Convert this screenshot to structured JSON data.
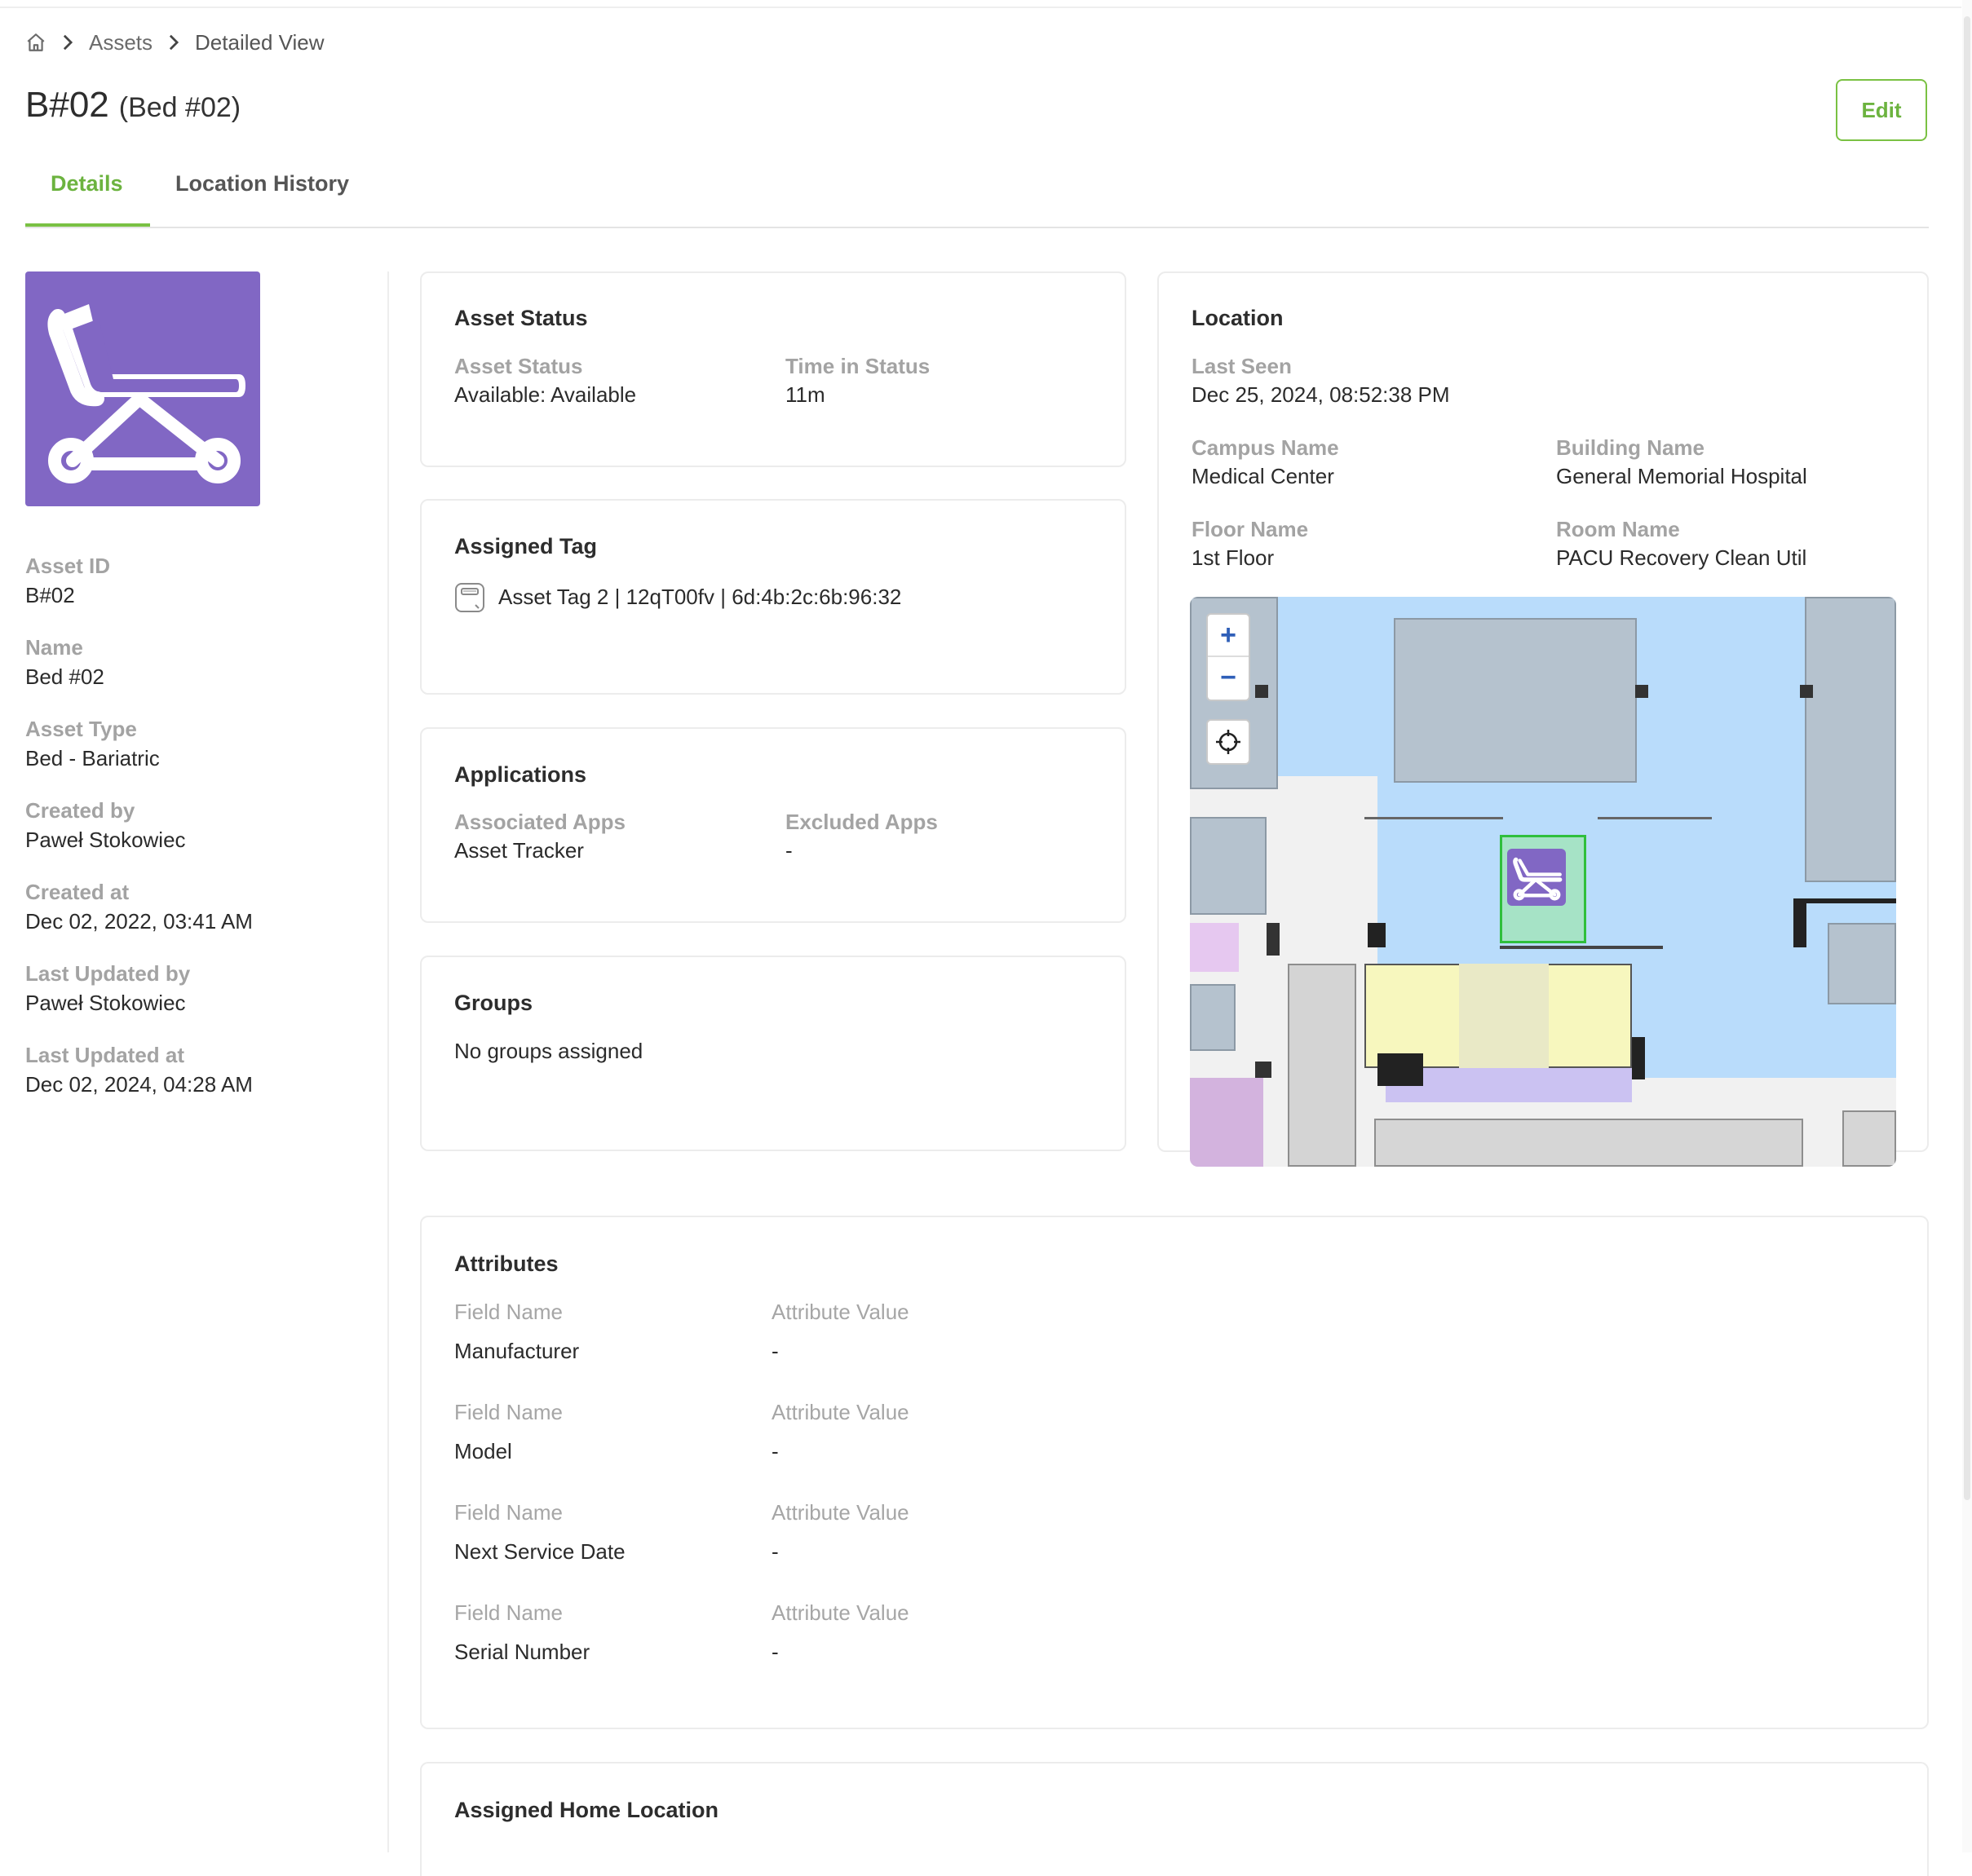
{
  "breadcrumb": {
    "home_icon": "home-icon",
    "items": [
      "Assets",
      "Detailed View"
    ]
  },
  "header": {
    "title": "B#02",
    "subtitle": "(Bed #02)",
    "edit_label": "Edit"
  },
  "tabs": [
    {
      "label": "Details",
      "active": true
    },
    {
      "label": "Location History",
      "active": false
    }
  ],
  "asset_icon": "bed-icon",
  "colors": {
    "accent": "#7ac143",
    "asset_purple": "#8167c4",
    "map_water": "#b9dcfb",
    "marker_border": "#2fbf3c"
  },
  "left_meta": [
    {
      "label": "Asset ID",
      "value": "B#02"
    },
    {
      "label": "Name",
      "value": "Bed #02"
    },
    {
      "label": "Asset Type",
      "value": "Bed - Bariatric"
    },
    {
      "label": "Created by",
      "value": "Paweł Stokowiec"
    },
    {
      "label": "Created at",
      "value": "Dec 02, 2022, 03:41 AM"
    },
    {
      "label": "Last Updated by",
      "value": "Paweł Stokowiec"
    },
    {
      "label": "Last Updated at",
      "value": "Dec 02, 2024, 04:28 AM"
    }
  ],
  "asset_status": {
    "title": "Asset Status",
    "status_label": "Asset Status",
    "status_value": "Available: Available",
    "time_label": "Time in Status",
    "time_value": "11m"
  },
  "assigned_tag": {
    "title": "Assigned Tag",
    "tag_icon": "tag-icon",
    "value": "Asset Tag 2 | 12qT00fv | 6d:4b:2c:6b:96:32"
  },
  "applications": {
    "title": "Applications",
    "associated_label": "Associated Apps",
    "associated_value": "Asset Tracker",
    "excluded_label": "Excluded Apps",
    "excluded_value": "-"
  },
  "groups": {
    "title": "Groups",
    "empty_text": "No groups assigned"
  },
  "location": {
    "title": "Location",
    "last_seen_label": "Last Seen",
    "last_seen_value": "Dec 25, 2024, 08:52:38 PM",
    "campus_label": "Campus Name",
    "campus_value": "Medical Center",
    "building_label": "Building Name",
    "building_value": "General Memorial Hospital",
    "floor_label": "Floor Name",
    "floor_value": "1st Floor",
    "room_label": "Room Name",
    "room_value": "PACU Recovery Clean Util",
    "zoom_in": "+",
    "zoom_out": "−",
    "locate_icon": "crosshair-icon"
  },
  "attributes": {
    "title": "Attributes",
    "field_label": "Field Name",
    "value_label": "Attribute Value",
    "rows": [
      {
        "field": "Manufacturer",
        "value": "-"
      },
      {
        "field": "Model",
        "value": "-"
      },
      {
        "field": "Next Service Date",
        "value": "-"
      },
      {
        "field": "Serial Number",
        "value": "-"
      }
    ]
  },
  "home_location": {
    "title": "Assigned Home Location"
  }
}
